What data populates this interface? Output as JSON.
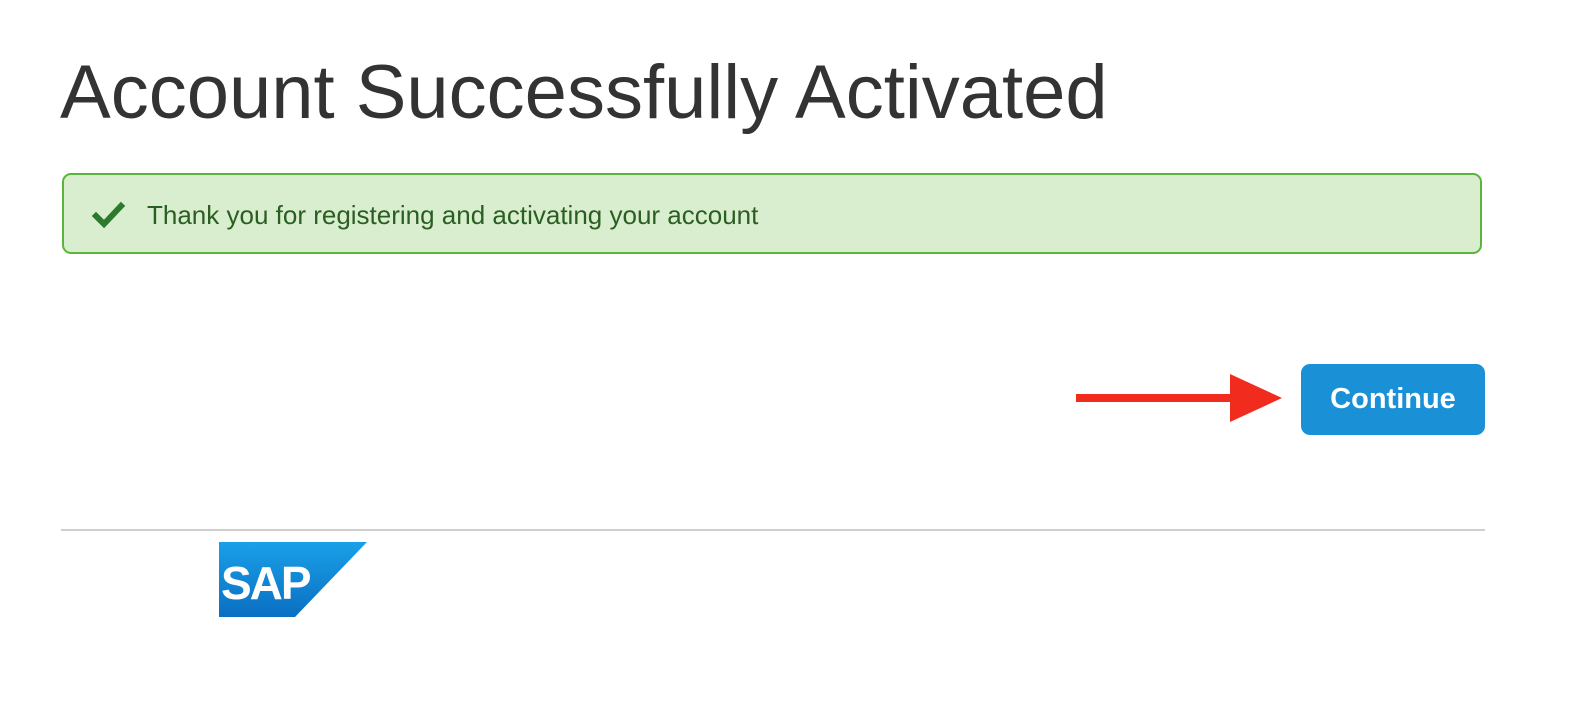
{
  "page": {
    "title": "Account Successfully Activated"
  },
  "alert": {
    "message": "Thank you for registering and activating your account",
    "icon": "checkmark-icon",
    "status": "success",
    "colors": {
      "background": "#d9eecf",
      "border": "#5bb43b",
      "text": "#2b5e23",
      "icon": "#2d7a2f"
    }
  },
  "actions": {
    "continue_label": "Continue",
    "continue_color": "#1a91d6"
  },
  "annotation": {
    "arrow_icon": "right-arrow-icon",
    "arrow_color": "#f22b1f"
  },
  "footer": {
    "logo_text": "SAP",
    "logo_mark": "®",
    "logo_colors": [
      "#0a6fc2",
      "#1aa0e8"
    ]
  }
}
